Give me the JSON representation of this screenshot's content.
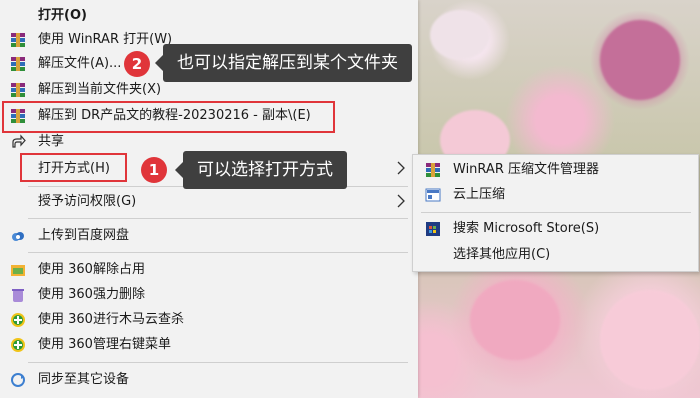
{
  "context_menu": {
    "items": [
      {
        "label": "打开(O)",
        "icon": "none"
      },
      {
        "label": "使用 WinRAR 打开(W)",
        "icon": "winrar-icon"
      },
      {
        "label": "解压文件(A)...",
        "icon": "winrar-icon"
      },
      {
        "label": "解压到当前文件夹(X)",
        "icon": "winrar-icon"
      },
      {
        "label": "解压到 DR产品文的教程-20230216 - 副本\\(E)",
        "icon": "winrar-icon"
      },
      {
        "label": "共享",
        "icon": "share-icon"
      },
      {
        "label": "打开方式(H)",
        "icon": "none"
      },
      {
        "label": "授予访问权限(G)",
        "icon": "none"
      },
      {
        "label": "上传到百度网盘",
        "icon": "baidu-cloud-icon"
      },
      {
        "label": "使用 360解除占用",
        "icon": "360-unlock-icon"
      },
      {
        "label": "使用 360强力删除",
        "icon": "360-delete-icon"
      },
      {
        "label": "使用 360进行木马云查杀",
        "icon": "360-scan-icon"
      },
      {
        "label": "使用 360管理右键菜单",
        "icon": "360-manage-icon"
      },
      {
        "label": "同步至其它设备",
        "icon": "sync-icon"
      }
    ]
  },
  "submenu": {
    "items": [
      {
        "label": "WinRAR 压缩文件管理器",
        "icon": "winrar-icon"
      },
      {
        "label": "云上压缩",
        "icon": "cloud-compress-icon"
      },
      {
        "label": "搜索 Microsoft Store(S)",
        "icon": "store-icon"
      },
      {
        "label": "选择其他应用(C)",
        "icon": "none"
      }
    ]
  },
  "annotations": {
    "callout1": {
      "number": "1",
      "text": "可以选择打开方式"
    },
    "callout2": {
      "number": "2",
      "text": "也可以指定解压到某个文件夹"
    }
  },
  "colors": {
    "highlight_red": "#e0353a",
    "callout_bg": "#3f3f3f",
    "menu_bg": "#f2f2f2"
  }
}
